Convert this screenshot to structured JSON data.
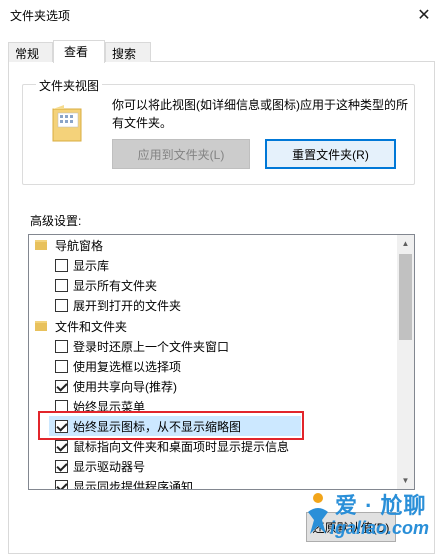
{
  "window": {
    "title": "文件夹选项"
  },
  "tabs": [
    {
      "label": "常规"
    },
    {
      "label": "查看"
    },
    {
      "label": "搜索"
    }
  ],
  "folder_views": {
    "label": "文件夹视图",
    "description": "你可以将此视图(如详细信息或图标)应用于这种类型的所有文件夹。",
    "apply_button": "应用到文件夹(L)",
    "reset_button": "重置文件夹(R)"
  },
  "advanced": {
    "label": "高级设置:",
    "items": [
      {
        "type": "folder",
        "label": "导航窗格"
      },
      {
        "type": "checkbox",
        "label": "显示库",
        "checked": false
      },
      {
        "type": "checkbox",
        "label": "显示所有文件夹",
        "checked": false
      },
      {
        "type": "checkbox",
        "label": "展开到打开的文件夹",
        "checked": false
      },
      {
        "type": "folder",
        "label": "文件和文件夹"
      },
      {
        "type": "checkbox",
        "label": "登录时还原上一个文件夹窗口",
        "checked": false
      },
      {
        "type": "checkbox",
        "label": "使用复选框以选择项",
        "checked": false
      },
      {
        "type": "checkbox",
        "label": "使用共享向导(推荐)",
        "checked": true
      },
      {
        "type": "checkbox",
        "label": "始终显示菜单",
        "checked": false
      },
      {
        "type": "checkbox",
        "label": "始终显示图标，从不显示缩略图",
        "checked": true
      },
      {
        "type": "checkbox",
        "label": "鼠标指向文件夹和桌面项时显示提示信息",
        "checked": true
      },
      {
        "type": "checkbox",
        "label": "显示驱动器号",
        "checked": true
      },
      {
        "type": "checkbox",
        "label": "显示同步提供程序通知",
        "checked": true
      }
    ]
  },
  "bottom": {
    "restore_button": "还原默认值(D)"
  },
  "watermark": {
    "brand": "爱 · 尬聊",
    "url": "igaliao.com"
  },
  "colors": {
    "highlight_border": "#e2252b",
    "accent": "#0078d7"
  }
}
